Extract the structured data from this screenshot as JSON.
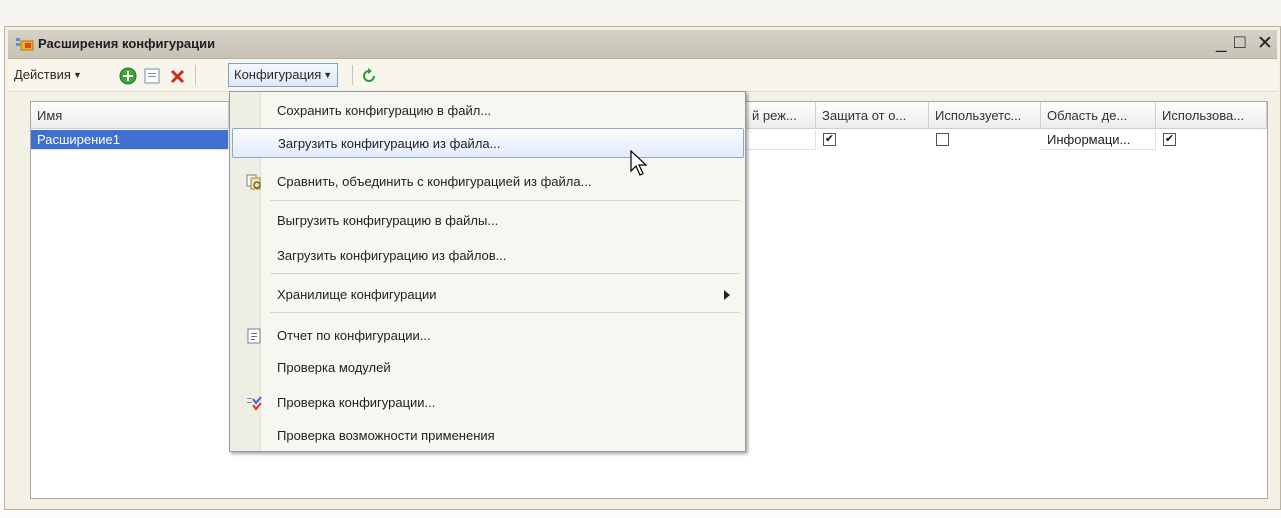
{
  "window": {
    "title": "Расширения конфигурации",
    "min": "_",
    "max": "□",
    "close": "✕"
  },
  "toolbar": {
    "actions_label": "Действия",
    "configuration_label": "Конфигурация"
  },
  "table": {
    "columns": [
      "Имя",
      "й реж...",
      "Защита от о...",
      "Используетс...",
      "Область де...",
      "Использова..."
    ],
    "rows": [
      {
        "name": "Расширение1",
        "protect": true,
        "uses": false,
        "area": "Информаци...",
        "use": true
      }
    ]
  },
  "menu": {
    "items": [
      "Сохранить конфигурацию в файл...",
      "Загрузить конфигурацию из файла...",
      "Сравнить, объединить с конфигурацией из файла...",
      "Выгрузить конфигурацию в файлы...",
      "Загрузить конфигурацию из файлов...",
      "Хранилище конфигурации",
      "Отчет по конфигурации...",
      "Проверка модулей",
      "Проверка конфигурации...",
      "Проверка возможности применения"
    ],
    "highlighted_index": 1
  },
  "colors": {
    "selection": "#3f6fd0",
    "menu_highlight": "#e3ecfa",
    "frame": "#f3f0e4"
  }
}
